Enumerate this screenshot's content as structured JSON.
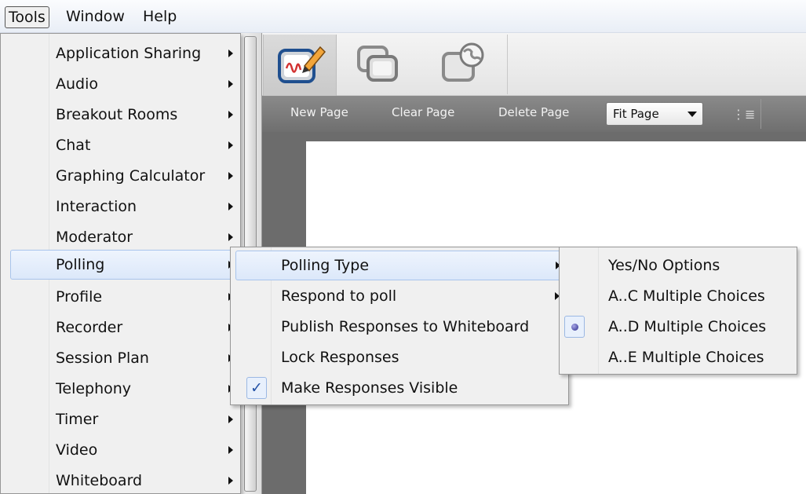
{
  "menubar": {
    "tools": "Tools",
    "window": "Window",
    "help": "Help"
  },
  "app": {
    "toolbar_sub": {
      "new_page": "New Page",
      "clear_page": "Clear Page",
      "delete_page": "Delete Page",
      "zoom_select": "Fit Page"
    },
    "tools": [
      {
        "icon": "whiteboard-icon",
        "selected": true
      },
      {
        "icon": "application-sharing-icon",
        "selected": false
      },
      {
        "icon": "web-tour-icon",
        "selected": false
      }
    ]
  },
  "tools_menu": {
    "items": [
      {
        "label": "Application Sharing",
        "has_submenu": true
      },
      {
        "label": "Audio",
        "has_submenu": true
      },
      {
        "label": "Breakout Rooms",
        "has_submenu": true
      },
      {
        "label": "Chat",
        "has_submenu": true
      },
      {
        "label": "Graphing Calculator",
        "has_submenu": true
      },
      {
        "label": "Interaction",
        "has_submenu": true
      },
      {
        "label": "Moderator",
        "has_submenu": true
      },
      {
        "label": "Polling",
        "has_submenu": true,
        "highlighted": true
      },
      {
        "label": "Profile",
        "has_submenu": true
      },
      {
        "label": "Recorder",
        "has_submenu": true
      },
      {
        "label": "Session Plan",
        "has_submenu": true
      },
      {
        "label": "Telephony",
        "has_submenu": true
      },
      {
        "label": "Timer",
        "has_submenu": true
      },
      {
        "label": "Video",
        "has_submenu": true
      },
      {
        "label": "Whiteboard",
        "has_submenu": true
      }
    ]
  },
  "polling_menu": {
    "items": [
      {
        "label": "Polling Type",
        "has_submenu": true,
        "highlighted": true
      },
      {
        "label": "Respond to poll",
        "has_submenu": true
      },
      {
        "label": "Publish Responses to Whiteboard"
      },
      {
        "label": "Lock Responses"
      },
      {
        "label": "Make Responses Visible",
        "checked": true
      }
    ]
  },
  "polling_type_menu": {
    "items": [
      {
        "label": "Yes/No Options"
      },
      {
        "label": "A..C Multiple Choices"
      },
      {
        "label": "A..D Multiple Choices",
        "selected": true
      },
      {
        "label": "A..E Multiple Choices"
      }
    ]
  },
  "colors": {
    "highlight": "#dce8fa",
    "menu_bg": "#f0f0f0",
    "toolbar_dark": "#6c6c6c"
  }
}
